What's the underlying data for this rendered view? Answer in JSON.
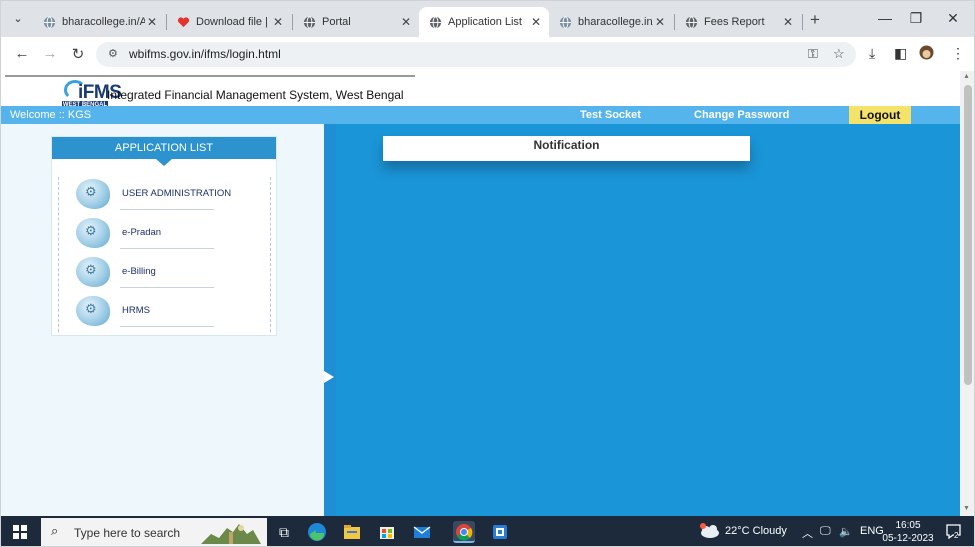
{
  "browser": {
    "tabs": [
      {
        "title": "bharacollege.in/Ad",
        "icon": "globe-icon",
        "active": false
      },
      {
        "title": "Download file | iLo",
        "icon": "ilovepdf-heart-icon",
        "active": false
      },
      {
        "title": "Portal",
        "icon": "globe-icon",
        "active": false
      },
      {
        "title": "Application List",
        "icon": "globe-icon",
        "active": true
      },
      {
        "title": "bharacollege.in/Fe",
        "icon": "globe-icon",
        "active": false
      },
      {
        "title": "Fees Report",
        "icon": "globe-icon",
        "active": false
      }
    ],
    "address": "wbifms.gov.in/ifms/login.html"
  },
  "page": {
    "logo_text": "iFMS",
    "logo_sub": "WEST BENGAL",
    "site_title": "Integrated Financial Management System, West Bengal",
    "welcome": "Welcome :: KGS",
    "menu": {
      "test_socket": "Test Socket",
      "change_password": "Change Password",
      "logout": "Logout"
    },
    "app_list": {
      "header": "APPLICATION LIST",
      "items": [
        {
          "label": "USER ADMINISTRATION"
        },
        {
          "label": "e-Pradan"
        },
        {
          "label": "e-Billing"
        },
        {
          "label": "HRMS"
        }
      ]
    },
    "notification_title": "Notification"
  },
  "taskbar": {
    "search_placeholder": "Type here to search",
    "weather": "22°C  Cloudy",
    "language": "ENG",
    "time": "16:05",
    "date": "05-12-2023",
    "notification_count": "2"
  },
  "colors": {
    "menubar": "#55b4ec",
    "content": "#1a95d8",
    "logout": "#f3e36a",
    "app_header": "#2d93cf"
  }
}
